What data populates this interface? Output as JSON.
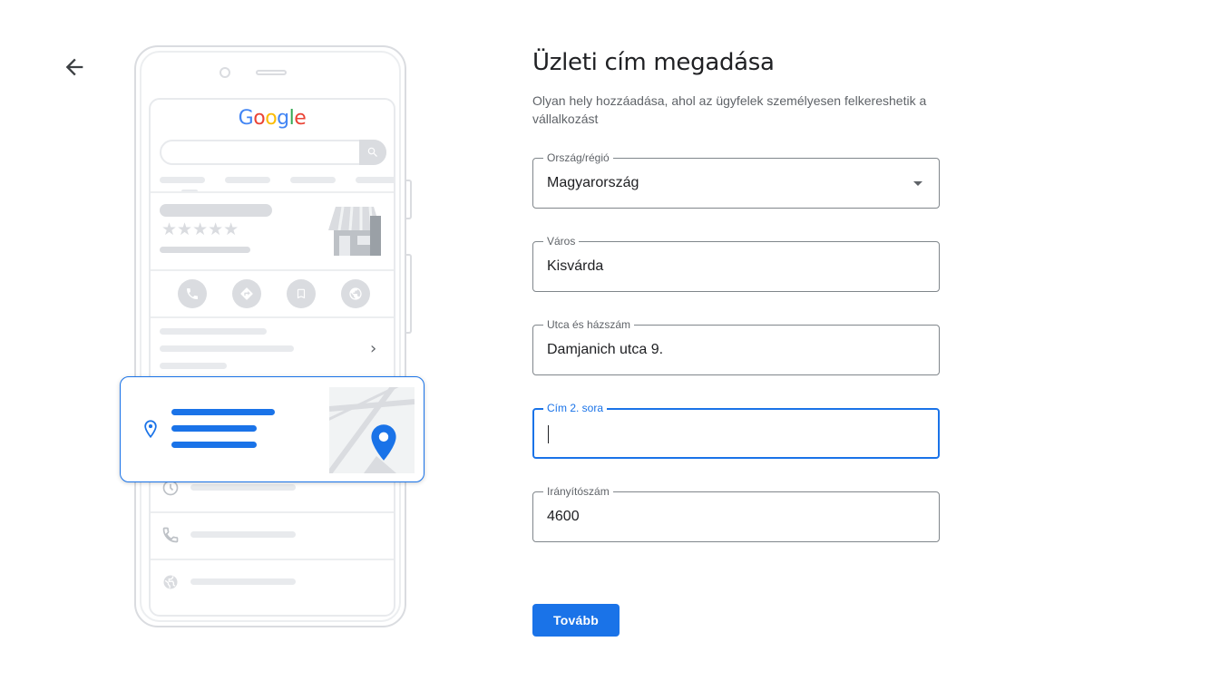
{
  "header": {
    "back_icon": "arrow-back-icon"
  },
  "illustration": {
    "logo": {
      "letters": [
        "G",
        "o",
        "o",
        "g",
        "l",
        "e"
      ],
      "colors": [
        "#4285f4",
        "#ea4335",
        "#fbbc05",
        "#4285f4",
        "#34a853",
        "#ea4335"
      ]
    },
    "rating_stars": "★★★★★",
    "chevron": "›",
    "icons": [
      "search-icon",
      "store-icon",
      "phone-icon",
      "directions-icon",
      "bookmark-icon",
      "globe-icon",
      "location-pin-icon",
      "map-pin-icon",
      "clock-icon"
    ],
    "accent_color": "#1a73e8"
  },
  "form": {
    "title": "Üzleti cím megadása",
    "subtitle": "Olyan hely hozzáadása, ahol az ügyfelek személyesen felkereshetik a vállalkozást",
    "fields": [
      {
        "label": "Ország/régió",
        "value": "Magyarország",
        "type": "select"
      },
      {
        "label": "Város",
        "value": "Kisvárda",
        "type": "text"
      },
      {
        "label": "Utca és házszám",
        "value": "Damjanich utca 9.",
        "type": "text"
      },
      {
        "label": "Cím 2. sora",
        "value": "",
        "type": "text",
        "focused": true
      },
      {
        "label": "Irányítószám",
        "value": "4600",
        "type": "text"
      }
    ],
    "next_label": "Tovább",
    "colors": {
      "primary": "#1a73e8",
      "border": "#80868b",
      "label": "#5f6368"
    }
  }
}
